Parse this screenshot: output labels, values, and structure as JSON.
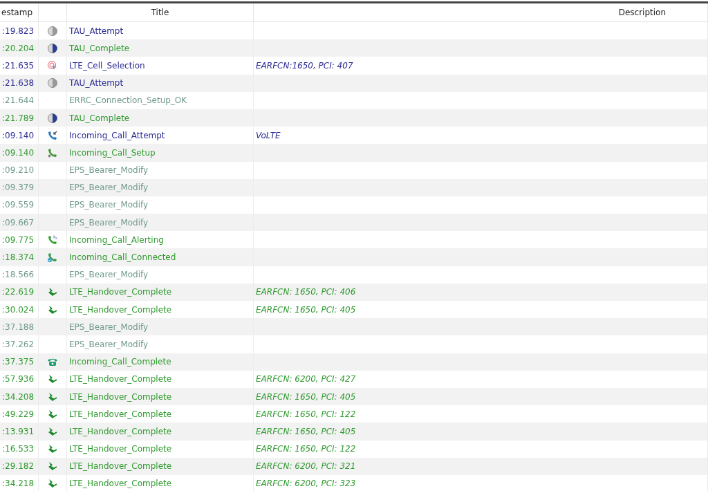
{
  "table": {
    "columns": [
      "estamp",
      "Title",
      "Description"
    ],
    "rows": [
      {
        "time": ":19.823",
        "kind": "tau_attempt",
        "title": "TAU_Attempt",
        "color": "#2a2a94"
      },
      {
        "time": ":20.204",
        "kind": "tau_complete",
        "title": "TAU_Complete",
        "color": "#2f9a2f"
      },
      {
        "time": ":21.635",
        "kind": "cell_select",
        "title": "LTE_Cell_Selection",
        "description": "EARFCN:1650, PCI: 407",
        "color": "#2a2a94"
      },
      {
        "time": ":21.638",
        "kind": "tau_attempt",
        "title": "TAU_Attempt",
        "color": "#2a2a94"
      },
      {
        "time": ":21.644",
        "kind": "plain",
        "title": "ERRC_Connection_Setup_OK",
        "color": "#6f9a8a"
      },
      {
        "time": ":21.789",
        "kind": "tau_complete",
        "title": "TAU_Complete",
        "color": "#2f9a2f"
      },
      {
        "time": ":09.140",
        "kind": "call_in",
        "title": "Incoming_Call_Attempt",
        "description": "VoLTE",
        "color": "#2a2a94"
      },
      {
        "time": ":09.140",
        "kind": "call_setup",
        "title": "Incoming_Call_Setup",
        "color": "#2f9a2f"
      },
      {
        "time": ":09.210",
        "kind": "plain",
        "title": "EPS_Bearer_Modify",
        "color": "#6f9a8a"
      },
      {
        "time": ":09.379",
        "kind": "plain",
        "title": "EPS_Bearer_Modify",
        "color": "#6f9a8a"
      },
      {
        "time": ":09.559",
        "kind": "plain",
        "title": "EPS_Bearer_Modify",
        "color": "#6f9a8a"
      },
      {
        "time": ":09.667",
        "kind": "plain",
        "title": "EPS_Bearer_Modify",
        "color": "#6f9a8a"
      },
      {
        "time": ":09.775",
        "kind": "call_alert",
        "title": "Incoming_Call_Alerting",
        "color": "#2f9a2f"
      },
      {
        "time": ":18.374",
        "kind": "call_connected",
        "title": "Incoming_Call_Connected",
        "color": "#2f9a2f"
      },
      {
        "time": ":18.566",
        "kind": "plain",
        "title": "EPS_Bearer_Modify",
        "color": "#6f9a8a"
      },
      {
        "time": ":22.619",
        "kind": "handover",
        "title": "LTE_Handover_Complete",
        "description": "EARFCN: 1650, PCI: 406",
        "color": "#2f9a2f"
      },
      {
        "time": ":30.024",
        "kind": "handover",
        "title": "LTE_Handover_Complete",
        "description": "EARFCN: 1650, PCI: 405",
        "color": "#2f9a2f"
      },
      {
        "time": ":37.188",
        "kind": "plain",
        "title": "EPS_Bearer_Modify",
        "color": "#6f9a8a"
      },
      {
        "time": ":37.262",
        "kind": "plain",
        "title": "EPS_Bearer_Modify",
        "color": "#6f9a8a"
      },
      {
        "time": ":37.375",
        "kind": "call_complete",
        "title": "Incoming_Call_Complete",
        "color": "#2f9a2f"
      },
      {
        "time": ":57.936",
        "kind": "handover",
        "title": "LTE_Handover_Complete",
        "description": "EARFCN: 6200, PCI: 427",
        "color": "#2f9a2f"
      },
      {
        "time": ":34.208",
        "kind": "handover",
        "title": "LTE_Handover_Complete",
        "description": "EARFCN: 1650, PCI: 405",
        "color": "#2f9a2f"
      },
      {
        "time": ":49.229",
        "kind": "handover",
        "title": "LTE_Handover_Complete",
        "description": "EARFCN: 1650, PCI: 122",
        "color": "#2f9a2f"
      },
      {
        "time": ":13.931",
        "kind": "handover",
        "title": "LTE_Handover_Complete",
        "description": "EARFCN: 1650, PCI: 405",
        "color": "#2f9a2f"
      },
      {
        "time": ":16.533",
        "kind": "handover",
        "title": "LTE_Handover_Complete",
        "description": "EARFCN: 1650, PCI: 122",
        "color": "#2f9a2f"
      },
      {
        "time": ":29.182",
        "kind": "handover",
        "title": "LTE_Handover_Complete",
        "description": "EARFCN: 6200, PCI: 321",
        "color": "#2f9a2f"
      },
      {
        "time": ":34.218",
        "kind": "handover",
        "title": "LTE_Handover_Complete",
        "description": "EARFCN: 6200, PCI: 323",
        "color": "#2f9a2f"
      }
    ]
  }
}
